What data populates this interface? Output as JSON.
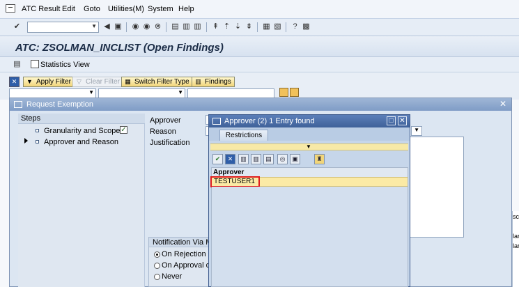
{
  "menubar": {
    "items": [
      "ATC Result",
      "Edit",
      "Goto",
      "Utilities(M)",
      "System",
      "Help"
    ]
  },
  "toolbar": {
    "command_value": ""
  },
  "header": {
    "title": "ATC:  ZSOLMAN_INCLIST (Open Findings)"
  },
  "apptoolbar": {
    "statistics_label": "Statistics View"
  },
  "filterbar": {
    "apply_filter": "Apply Filter",
    "clear_filter": "Clear Filter",
    "switch_filter_type": "Switch Filter Type",
    "findings": "Findings"
  },
  "dialog": {
    "title": "Request Exemption",
    "steps_header": "Steps",
    "steps": [
      "Granularity and Scope",
      "Approver and Reason"
    ],
    "form": {
      "approver_label": "Approver",
      "reason_label": "Reason",
      "justification_label": "Justification"
    },
    "notification": {
      "title": "Notification Via Mail",
      "options": [
        "On Rejection",
        "On Approval or O",
        "Never"
      ],
      "selected": 0
    }
  },
  "popup": {
    "title": "Approver (2)    1 Entry found",
    "tab": "Restrictions",
    "column_header": "Approver",
    "rows": [
      "TESTUSER1"
    ]
  },
  "right": {
    "fragments": [
      "lar",
      "lar",
      "sc"
    ]
  }
}
